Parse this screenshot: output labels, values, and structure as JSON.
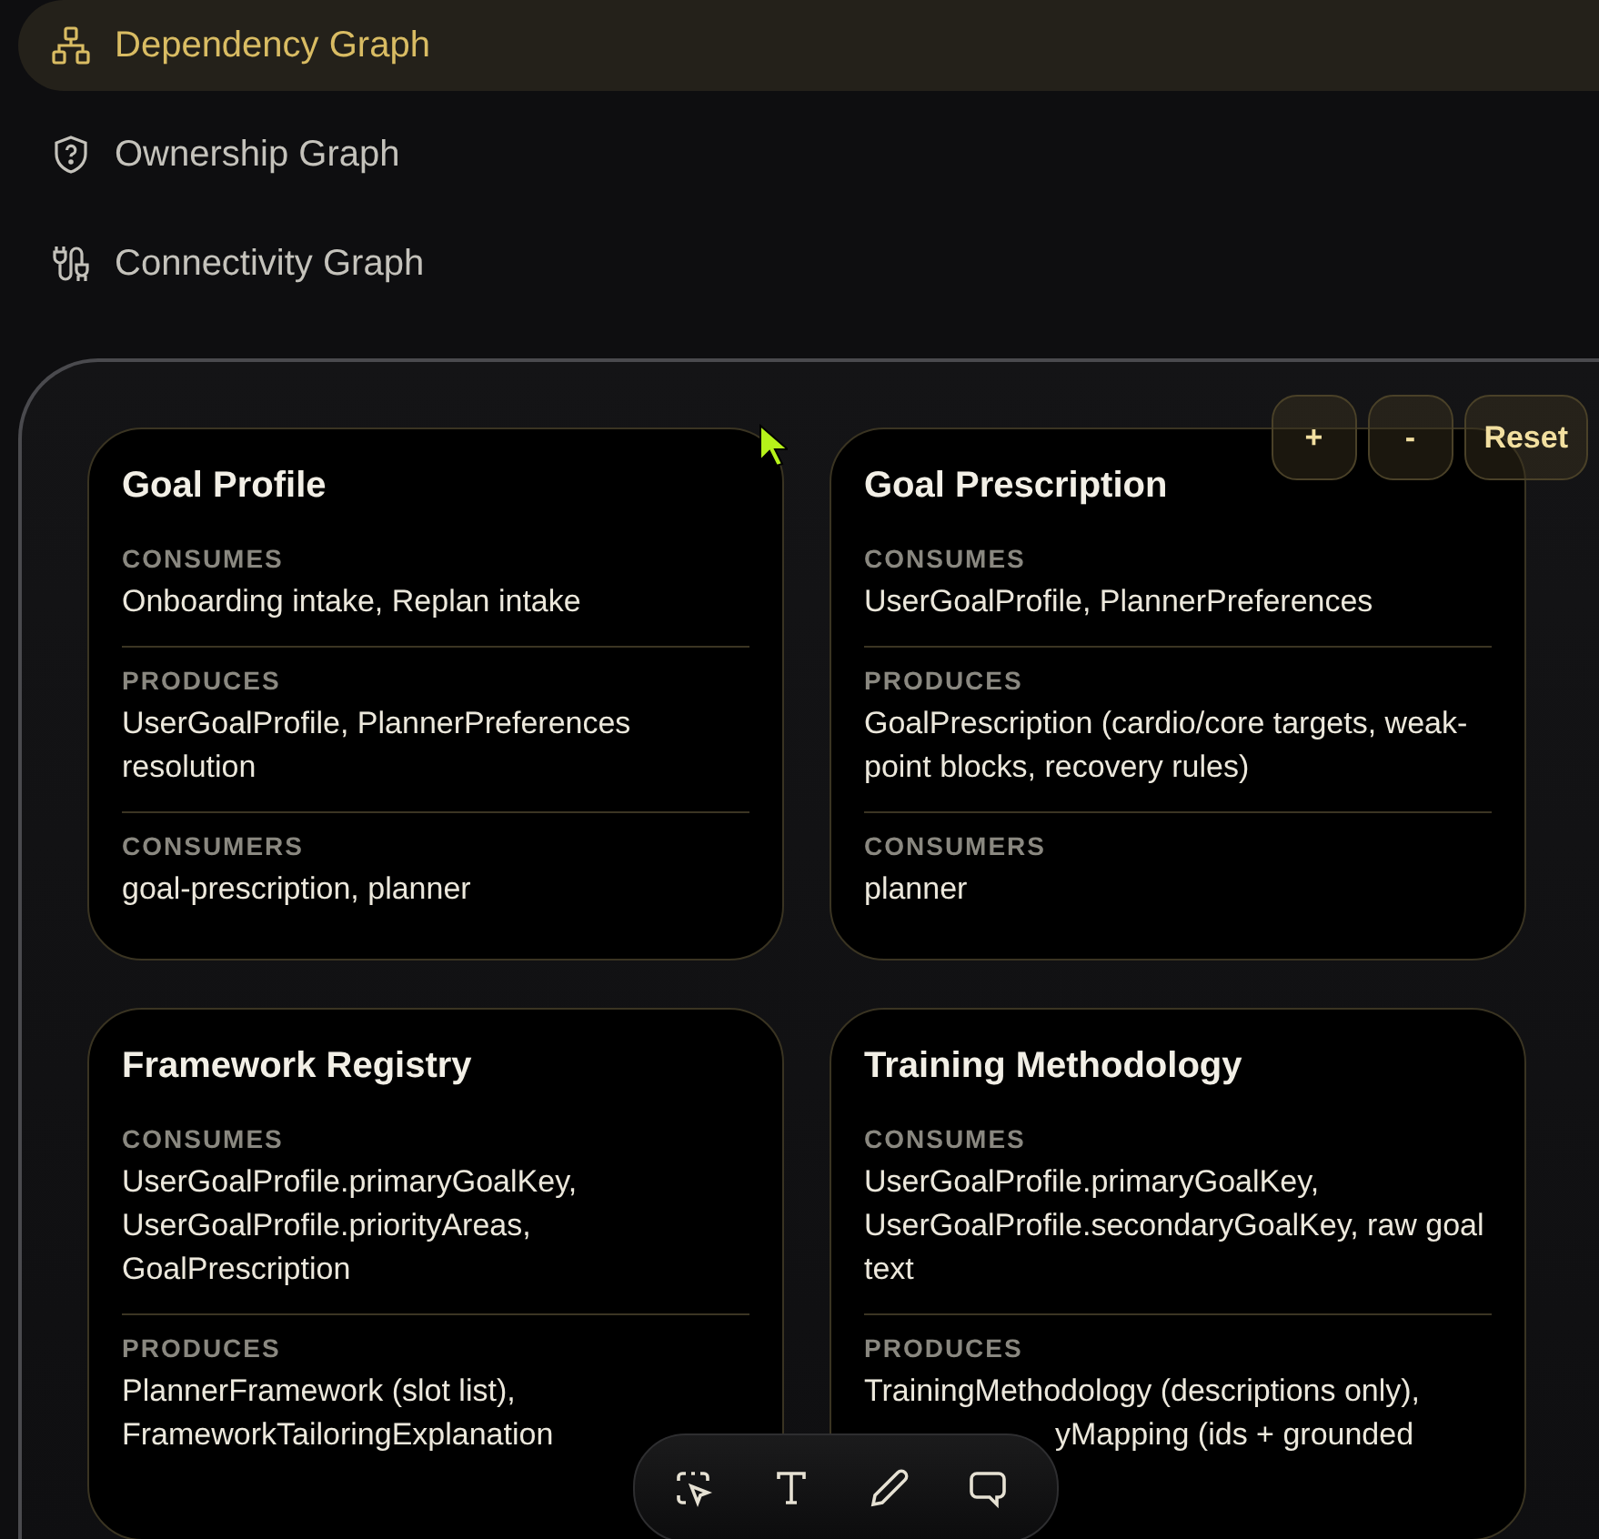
{
  "nav": [
    {
      "label": "Dependency Graph",
      "kind": "hierarchy",
      "selected": true
    },
    {
      "label": "Ownership Graph",
      "kind": "shield",
      "selected": false
    },
    {
      "label": "Connectivity Graph",
      "kind": "plug",
      "selected": false
    }
  ],
  "zoom_buttons": [
    "+",
    "-",
    "Reset"
  ],
  "cards": [
    {
      "title": "Goal Profile",
      "sections": [
        {
          "label": "CONSUMES",
          "value": "Onboarding intake, Replan intake"
        },
        {
          "label": "PRODUCES",
          "value": "UserGoalProfile, PlannerPreferences resolution"
        },
        {
          "label": "CONSUMERS",
          "value": "goal-prescription, planner"
        }
      ]
    },
    {
      "title": "Goal Prescription",
      "sections": [
        {
          "label": "CONSUMES",
          "value": "UserGoalProfile, PlannerPreferences"
        },
        {
          "label": "PRODUCES",
          "value": "GoalPrescription (cardio/core targets, weak-point blocks, recovery rules)"
        },
        {
          "label": "CONSUMERS",
          "value": "planner"
        }
      ]
    },
    {
      "title": "Framework Registry",
      "sections": [
        {
          "label": "CONSUMES",
          "value": "UserGoalProfile.primaryGoalKey, UserGoalProfile.priorityAreas, GoalPrescription"
        },
        {
          "label": "PRODUCES",
          "value": "PlannerFramework (slot list), FrameworkTailoringExplanation"
        }
      ]
    },
    {
      "title": "Training Methodology",
      "sections": [
        {
          "label": "CONSUMES",
          "value": "UserGoalProfile.primaryGoalKey, UserGoalProfile.secondaryGoalKey, raw goal text"
        },
        {
          "label": "PRODUCES",
          "value": "TrainingMethodology (descriptions only),",
          "covered_tail": "yMapping (ids + grounded"
        }
      ]
    }
  ],
  "toolbar": [
    {
      "kind": "select"
    },
    {
      "kind": "text"
    },
    {
      "kind": "pen"
    },
    {
      "kind": "comment"
    }
  ]
}
